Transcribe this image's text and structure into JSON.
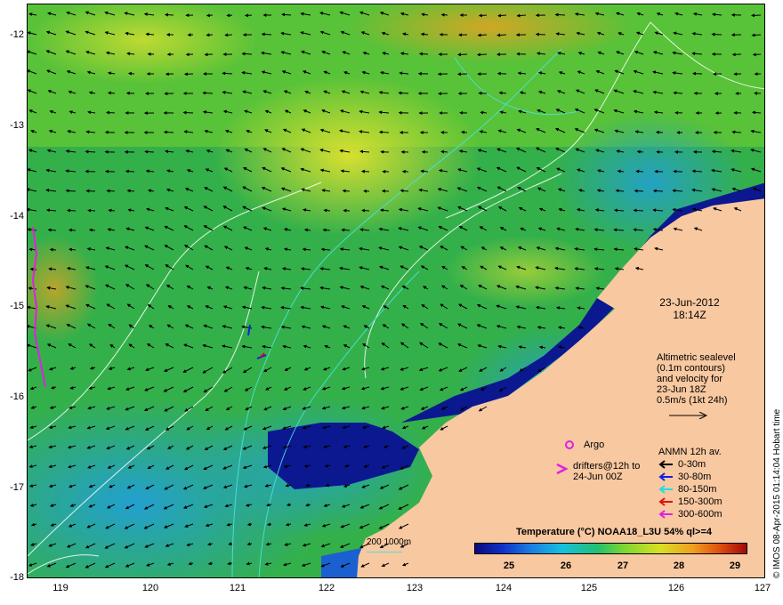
{
  "map": {
    "date": "23-Jun-2012",
    "time": "18:14Z",
    "altimetry_lines": [
      "Altimetric sealevel",
      "(0.1m contours)",
      "and velocity for",
      "23-Jun 18Z",
      "0.5m/s (1kt 24h)"
    ],
    "argo_label": "Argo",
    "drifters_lines": [
      "drifters@12h to",
      "24-Jun 00Z"
    ],
    "anmn_title": "ANMN 12h av.",
    "anmn_items": [
      {
        "label": "0-30m",
        "color": "#000000"
      },
      {
        "label": "30-80m",
        "color": "#1020e0"
      },
      {
        "label": "80-150m",
        "color": "#20e0e0"
      },
      {
        "label": "150-300m",
        "color": "#e01010"
      },
      {
        "label": "300-600m",
        "color": "#e020e0"
      }
    ],
    "colorbar_title": "Temperature (°C) NOAA18_L3U 54% ql>=4",
    "colorbar_ticks": [
      "25",
      "26",
      "27",
      "28",
      "29"
    ],
    "depth_label": "200  1000m",
    "credit": "© IMOS 08-Apr-2015 01:14:04 Hobart time",
    "y_ticks": [
      "-12",
      "-13",
      "-14",
      "-15",
      "-16",
      "-17",
      "-18"
    ],
    "x_ticks": [
      "119",
      "120",
      "121",
      "122",
      "123",
      "124",
      "125",
      "126",
      "127"
    ],
    "colors": {
      "land": "#f8c8a0",
      "deep_sst": "#0a0a7a",
      "argo": "#e020e0"
    }
  }
}
